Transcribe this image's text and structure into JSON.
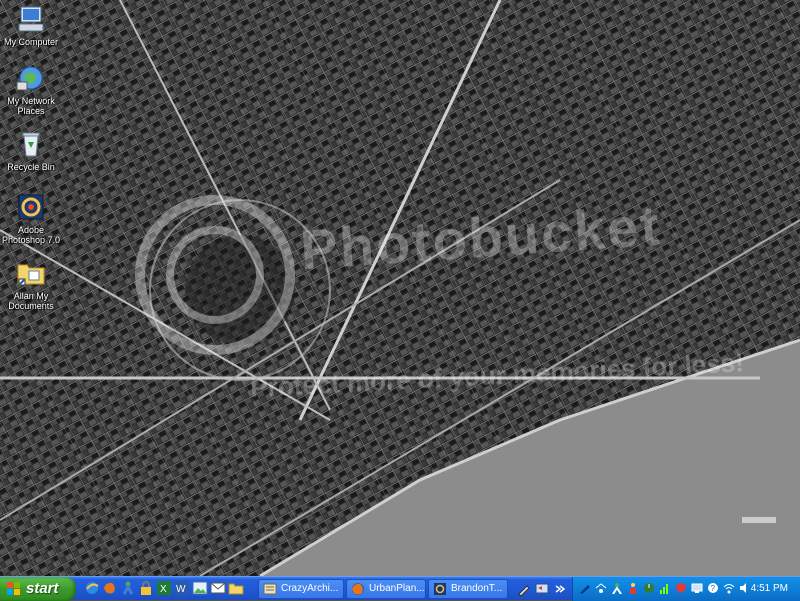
{
  "desktop": {
    "icons": [
      {
        "label": "My Computer"
      },
      {
        "label": "My Network Places"
      },
      {
        "label": "Recycle Bin"
      },
      {
        "label": "Adobe Photoshop 7.0"
      },
      {
        "label": "Allan My Documents"
      }
    ],
    "watermark": "Photobucket",
    "watermark_sub": "Protect more of your memories for less!"
  },
  "taskbar": {
    "start_label": "start",
    "tasks": [
      {
        "label": "CrazyArchi...",
        "icon": "archive-icon"
      },
      {
        "label": "UrbanPlan...",
        "icon": "firefox-icon"
      },
      {
        "label": "BrandonT...",
        "icon": "photoshop-icon"
      }
    ],
    "clock": "4:51 PM"
  },
  "colors": {
    "taskbar": "#245edb",
    "start_green": "#3c9a2b",
    "tray": "#0f7fd8"
  }
}
